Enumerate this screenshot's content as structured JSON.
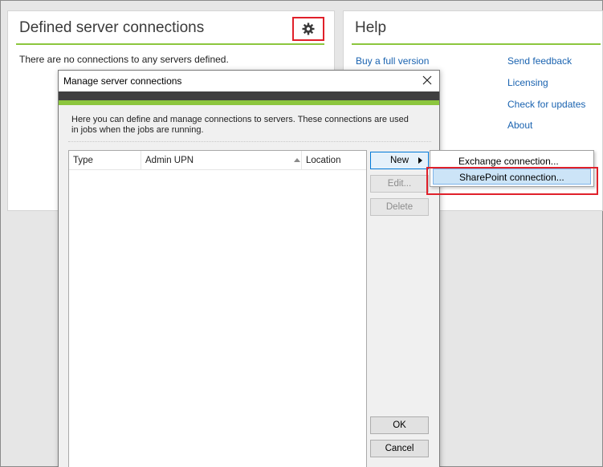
{
  "left_panel": {
    "title": "Defined server connections",
    "empty_message": "There are no connections to any servers defined."
  },
  "help_panel": {
    "title": "Help",
    "links_col1": [
      "Buy a full version"
    ],
    "links_col2": [
      "Send feedback",
      "Licensing",
      "Check for updates",
      "About"
    ]
  },
  "dialog": {
    "title": "Manage server connections",
    "description": "Here you can define and manage connections to servers. These connections are used in jobs when the jobs are running.",
    "columns": [
      "Type",
      "Admin UPN",
      "Location"
    ],
    "buttons": {
      "new": "New",
      "edit": "Edit...",
      "delete": "Delete",
      "ok": "OK",
      "cancel": "Cancel"
    }
  },
  "context_menu": {
    "items": [
      "Exchange connection...",
      "SharePoint connection..."
    ]
  },
  "colors": {
    "accent_green": "#8cc63e",
    "highlight_red": "#e0202a",
    "link_blue": "#1a63b0"
  }
}
